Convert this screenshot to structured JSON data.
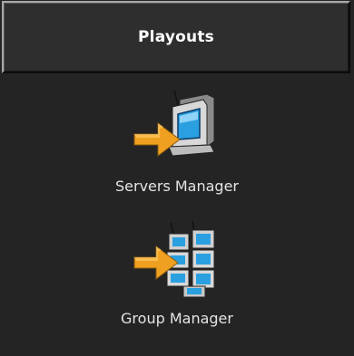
{
  "panel": {
    "title": "Playouts"
  },
  "items": [
    {
      "label": "Servers Manager",
      "icon": "server-monitor-arrow-icon"
    },
    {
      "label": "Group Manager",
      "icon": "server-group-arrow-icon"
    }
  ],
  "colors": {
    "background": "#242424",
    "header_background": "#2e2e2e",
    "title_text": "#ffffff",
    "label_text": "#e4e4e4",
    "arrow_orange": "#f0a020",
    "screen_blue": "#2aa0e0"
  }
}
